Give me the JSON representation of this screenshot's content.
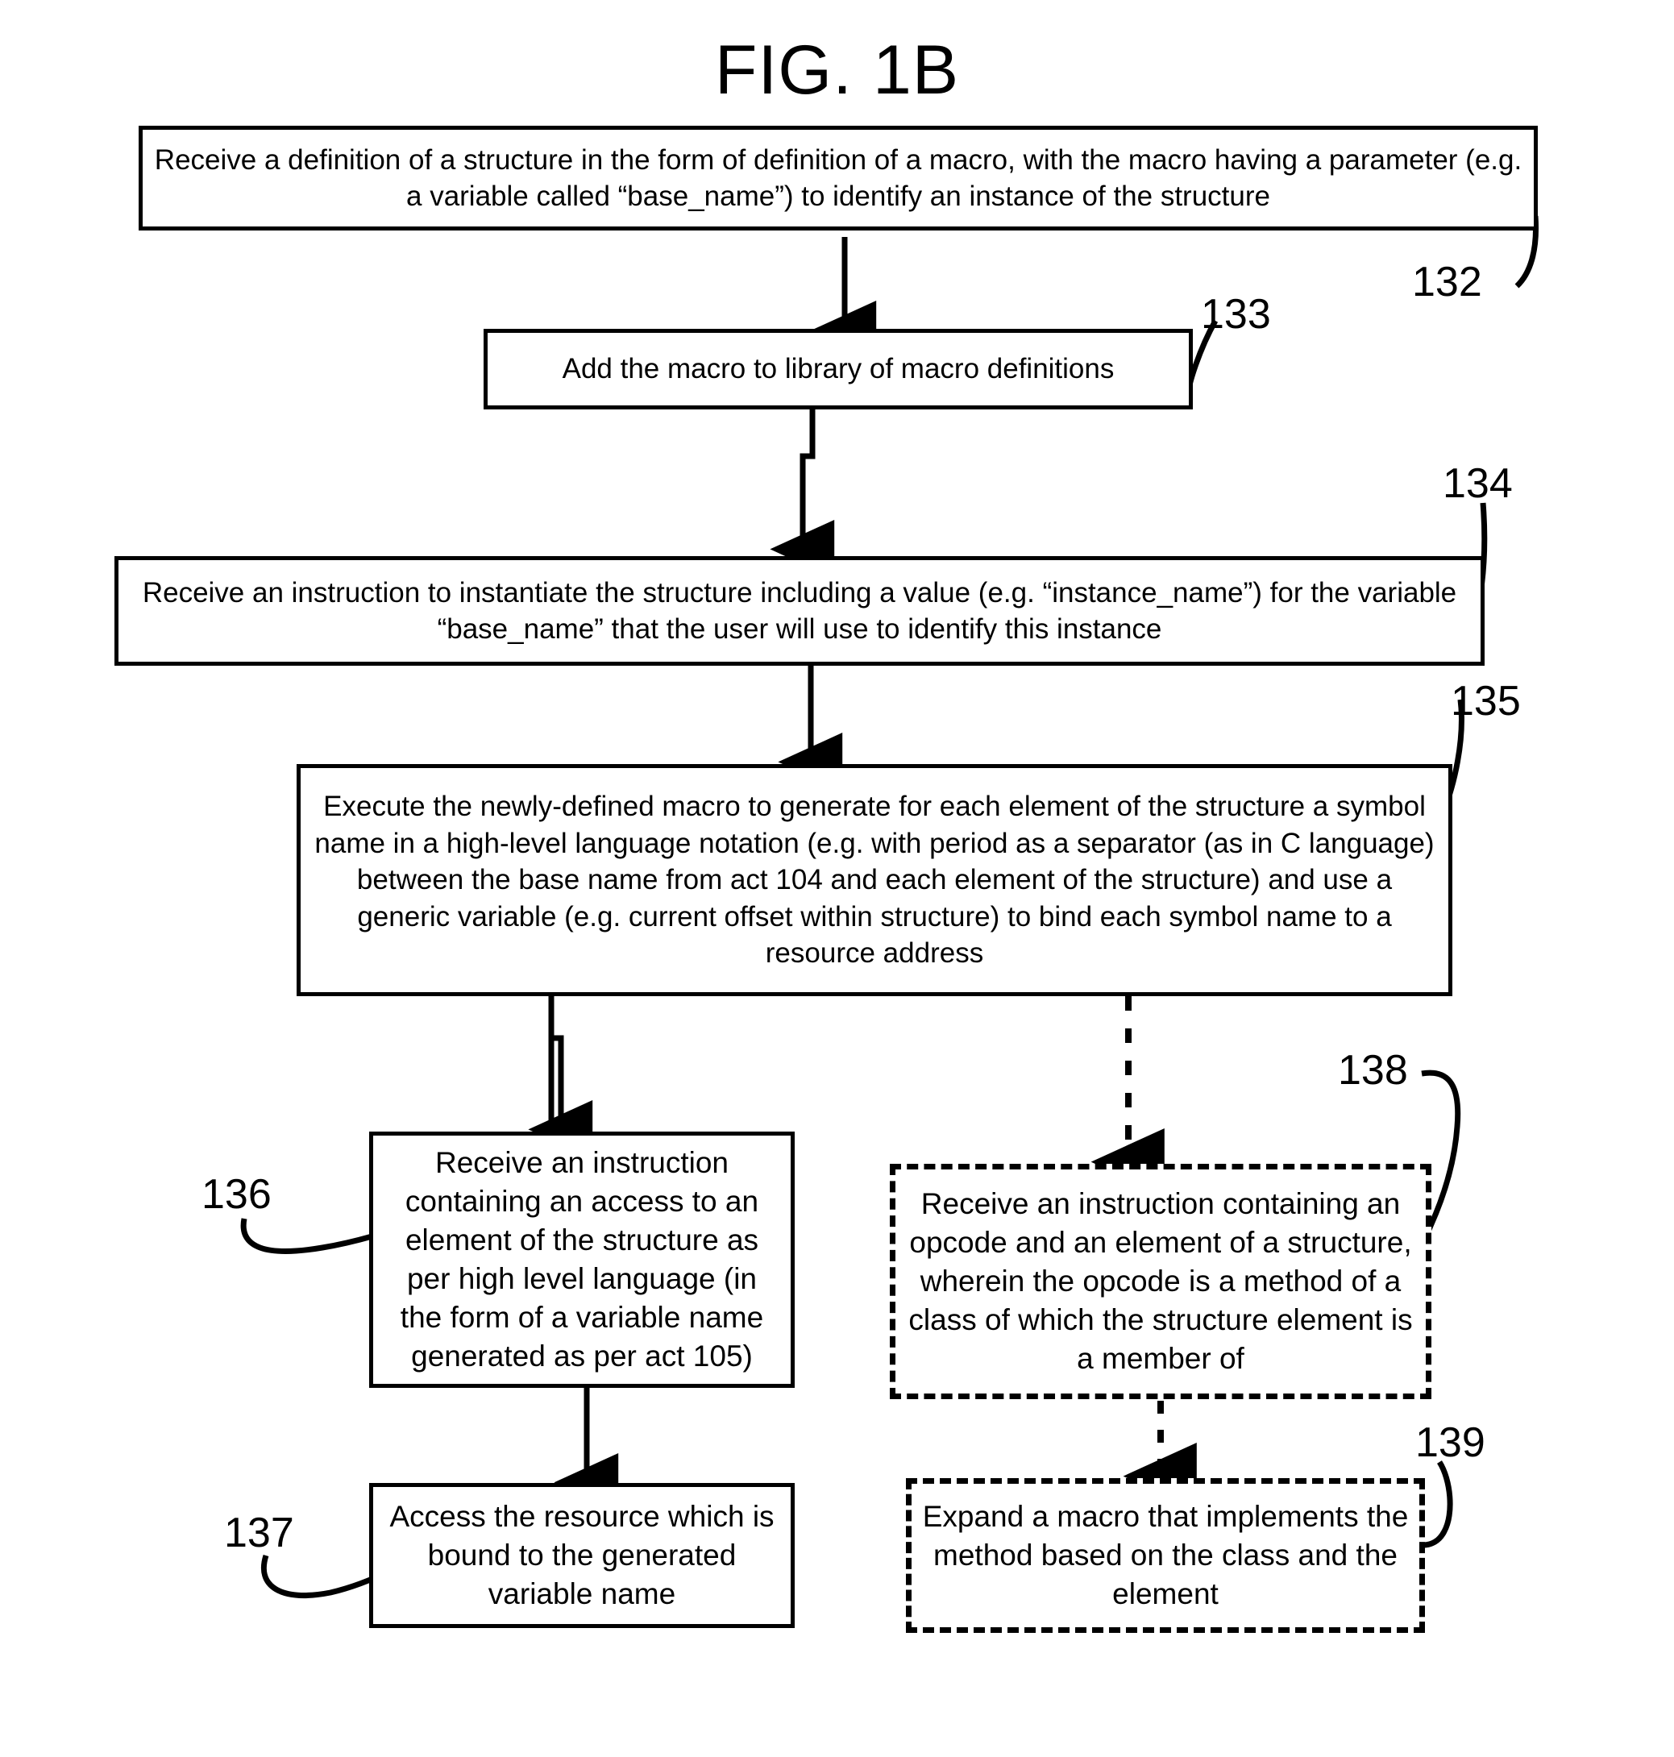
{
  "figure": {
    "title": "FIG. 1B"
  },
  "nodes": [
    {
      "id": "132",
      "ref": "132",
      "style": "solid",
      "text": "Receive a definition of a structure in the form of definition of a macro,  with the macro having a parameter (e.g. a variable called “base_name”) to identify an instance of the structure"
    },
    {
      "id": "133",
      "ref": "133",
      "style": "solid",
      "text": "Add the macro to library of macro definitions"
    },
    {
      "id": "134",
      "ref": "134",
      "style": "solid",
      "text": "Receive an instruction to instantiate the structure including a value (e.g. “instance_name”) for the variable “base_name” that the user will use to identify this instance"
    },
    {
      "id": "135",
      "ref": "135",
      "style": "solid",
      "text": "Execute the newly-defined macro to generate for each element of the structure a symbol name in a high-level language notation (e.g. with period as a separator (as in C language) between the base name from act 104 and each element of the structure) and use a generic variable (e.g. current offset within structure) to bind each symbol name to a resource address"
    },
    {
      "id": "136",
      "ref": "136",
      "style": "solid",
      "text": "Receive an instruction containing an access to an element of the structure as per high level language (in the form of a variable name generated as per act 105)"
    },
    {
      "id": "137",
      "ref": "137",
      "style": "solid",
      "text": "Access the resource which is bound to the generated variable name"
    },
    {
      "id": "138",
      "ref": "138",
      "style": "dashed",
      "text": "Receive an instruction containing an opcode and an element of a structure, wherein the opcode is a method of a class of which the structure element is a member of"
    },
    {
      "id": "139",
      "ref": "139",
      "style": "dashed",
      "text": "Expand a macro that implements the method based on the class and the element"
    }
  ],
  "ref_labels": {
    "n132": "132",
    "n133": "133",
    "n134": "134",
    "n135": "135",
    "n136": "136",
    "n137": "137",
    "n138": "138",
    "n139": "139"
  },
  "colors": {
    "stroke": "#000000",
    "background": "#ffffff"
  }
}
